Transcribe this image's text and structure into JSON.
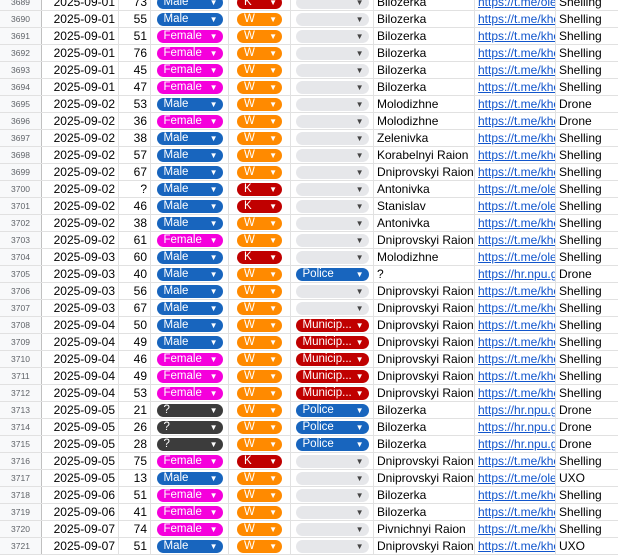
{
  "colors": {
    "Male": "#1865be",
    "Female": "#f500dc",
    "?": "#3c3c3c",
    "W": "#ff8a00",
    "K": "#c00000",
    "Police": "#1865be",
    "Municip...": "#c00000",
    "": "#e6e7ea"
  },
  "rows": [
    {
      "n": "3689",
      "date": "2025-09-01",
      "age": "73",
      "sex": "Male",
      "reg": "K",
      "cat": "",
      "place": "Bilozerka",
      "src": "https://t.me/olexa",
      "type": "Shelling"
    },
    {
      "n": "3690",
      "date": "2025-09-01",
      "age": "55",
      "sex": "Male",
      "reg": "W",
      "cat": "",
      "place": "Bilozerka",
      "src": "https://t.me/khers",
      "type": "Shelling"
    },
    {
      "n": "3691",
      "date": "2025-09-01",
      "age": "51",
      "sex": "Female",
      "reg": "W",
      "cat": "",
      "place": "Bilozerka",
      "src": "https://t.me/khers",
      "type": "Shelling"
    },
    {
      "n": "3692",
      "date": "2025-09-01",
      "age": "76",
      "sex": "Female",
      "reg": "W",
      "cat": "",
      "place": "Bilozerka",
      "src": "https://t.me/khers",
      "type": "Shelling"
    },
    {
      "n": "3693",
      "date": "2025-09-01",
      "age": "45",
      "sex": "Female",
      "reg": "W",
      "cat": "",
      "place": "Bilozerka",
      "src": "https://t.me/khers",
      "type": "Shelling"
    },
    {
      "n": "3694",
      "date": "2025-09-01",
      "age": "47",
      "sex": "Female",
      "reg": "W",
      "cat": "",
      "place": "Bilozerka",
      "src": "https://t.me/khers",
      "type": "Shelling"
    },
    {
      "n": "3695",
      "date": "2025-09-02",
      "age": "53",
      "sex": "Male",
      "reg": "W",
      "cat": "",
      "place": "Molodizhne",
      "src": "https://t.me/khers",
      "type": "Drone"
    },
    {
      "n": "3696",
      "date": "2025-09-02",
      "age": "36",
      "sex": "Female",
      "reg": "W",
      "cat": "",
      "place": "Molodizhne",
      "src": "https://t.me/khers",
      "type": "Drone"
    },
    {
      "n": "3697",
      "date": "2025-09-02",
      "age": "38",
      "sex": "Male",
      "reg": "W",
      "cat": "",
      "place": "Zelenivka",
      "src": "https://t.me/khers",
      "type": "Shelling"
    },
    {
      "n": "3698",
      "date": "2025-09-02",
      "age": "57",
      "sex": "Male",
      "reg": "W",
      "cat": "",
      "place": "Korabelnyi Raion",
      "src": "https://t.me/khers",
      "type": "Shelling"
    },
    {
      "n": "3699",
      "date": "2025-09-02",
      "age": "67",
      "sex": "Male",
      "reg": "W",
      "cat": "",
      "place": "Dniprovskyi Raion",
      "src": "https://t.me/khers",
      "type": "Shelling"
    },
    {
      "n": "3700",
      "date": "2025-09-02",
      "age": "?",
      "sex": "Male",
      "reg": "K",
      "cat": "",
      "place": "Antonivka",
      "src": "https://t.me/olexa",
      "type": "Shelling"
    },
    {
      "n": "3701",
      "date": "2025-09-02",
      "age": "46",
      "sex": "Male",
      "reg": "K",
      "cat": "",
      "place": "Stanislav",
      "src": "https://t.me/olexa",
      "type": "Shelling"
    },
    {
      "n": "3702",
      "date": "2025-09-02",
      "age": "38",
      "sex": "Male",
      "reg": "W",
      "cat": "",
      "place": "Antonivka",
      "src": "https://t.me/khers",
      "type": "Shelling"
    },
    {
      "n": "3703",
      "date": "2025-09-02",
      "age": "61",
      "sex": "Female",
      "reg": "W",
      "cat": "",
      "place": "Dniprovskyi Raion",
      "src": "https://t.me/khers",
      "type": "Shelling"
    },
    {
      "n": "3704",
      "date": "2025-09-03",
      "age": "60",
      "sex": "Male",
      "reg": "K",
      "cat": "",
      "place": "Molodizhne",
      "src": "https://t.me/olexa",
      "type": "Shelling"
    },
    {
      "n": "3705",
      "date": "2025-09-03",
      "age": "40",
      "sex": "Male",
      "reg": "W",
      "cat": "Police",
      "place": "?",
      "src": "https://hr.npu.go",
      "type": "Drone"
    },
    {
      "n": "3706",
      "date": "2025-09-03",
      "age": "56",
      "sex": "Male",
      "reg": "W",
      "cat": "",
      "place": "Dniprovskyi Raion",
      "src": "https://t.me/khers",
      "type": "Shelling"
    },
    {
      "n": "3707",
      "date": "2025-09-03",
      "age": "67",
      "sex": "Male",
      "reg": "W",
      "cat": "",
      "place": "Dniprovskyi Raion",
      "src": "https://t.me/khers",
      "type": "Shelling"
    },
    {
      "n": "3708",
      "date": "2025-09-04",
      "age": "50",
      "sex": "Male",
      "reg": "W",
      "cat": "Municip...",
      "place": "Dniprovskyi Raion",
      "src": "https://t.me/khers",
      "type": "Shelling"
    },
    {
      "n": "3709",
      "date": "2025-09-04",
      "age": "49",
      "sex": "Male",
      "reg": "W",
      "cat": "Municip...",
      "place": "Dniprovskyi Raion",
      "src": "https://t.me/khers",
      "type": "Shelling"
    },
    {
      "n": "3710",
      "date": "2025-09-04",
      "age": "46",
      "sex": "Female",
      "reg": "W",
      "cat": "Municip...",
      "place": "Dniprovskyi Raion",
      "src": "https://t.me/khers",
      "type": "Shelling"
    },
    {
      "n": "3711",
      "date": "2025-09-04",
      "age": "49",
      "sex": "Female",
      "reg": "W",
      "cat": "Municip...",
      "place": "Dniprovskyi Raion",
      "src": "https://t.me/khers",
      "type": "Shelling"
    },
    {
      "n": "3712",
      "date": "2025-09-04",
      "age": "53",
      "sex": "Female",
      "reg": "W",
      "cat": "Municip...",
      "place": "Dniprovskyi Raion",
      "src": "https://t.me/khers",
      "type": "Shelling"
    },
    {
      "n": "3713",
      "date": "2025-09-05",
      "age": "21",
      "sex": "?",
      "reg": "W",
      "cat": "Police",
      "place": "Bilozerka",
      "src": "https://hr.npu.go",
      "type": "Drone"
    },
    {
      "n": "3714",
      "date": "2025-09-05",
      "age": "26",
      "sex": "?",
      "reg": "W",
      "cat": "Police",
      "place": "Bilozerka",
      "src": "https://hr.npu.go",
      "type": "Drone"
    },
    {
      "n": "3715",
      "date": "2025-09-05",
      "age": "28",
      "sex": "?",
      "reg": "W",
      "cat": "Police",
      "place": "Bilozerka",
      "src": "https://hr.npu.go",
      "type": "Drone"
    },
    {
      "n": "3716",
      "date": "2025-09-05",
      "age": "75",
      "sex": "Female",
      "reg": "K",
      "cat": "",
      "place": "Dniprovskyi Raion",
      "src": "https://t.me/khers",
      "type": "Shelling"
    },
    {
      "n": "3717",
      "date": "2025-09-05",
      "age": "13",
      "sex": "Male",
      "reg": "W",
      "cat": "",
      "place": "Dniprovskyi Raion",
      "src": "https://t.me/olexa",
      "type": "UXO"
    },
    {
      "n": "3718",
      "date": "2025-09-06",
      "age": "51",
      "sex": "Female",
      "reg": "W",
      "cat": "",
      "place": "Bilozerka",
      "src": "https://t.me/khers",
      "type": "Shelling"
    },
    {
      "n": "3719",
      "date": "2025-09-06",
      "age": "41",
      "sex": "Female",
      "reg": "W",
      "cat": "",
      "place": "Bilozerka",
      "src": "https://t.me/khers",
      "type": "Shelling"
    },
    {
      "n": "3720",
      "date": "2025-09-07",
      "age": "74",
      "sex": "Female",
      "reg": "W",
      "cat": "",
      "place": "Pivnichnyi Raion",
      "src": "https://t.me/khers",
      "type": "Shelling"
    },
    {
      "n": "3721",
      "date": "2025-09-07",
      "age": "51",
      "sex": "Male",
      "reg": "W",
      "cat": "",
      "place": "Dniprovskyi Raion",
      "src": "https://t.me/khers",
      "type": "UXO"
    }
  ]
}
